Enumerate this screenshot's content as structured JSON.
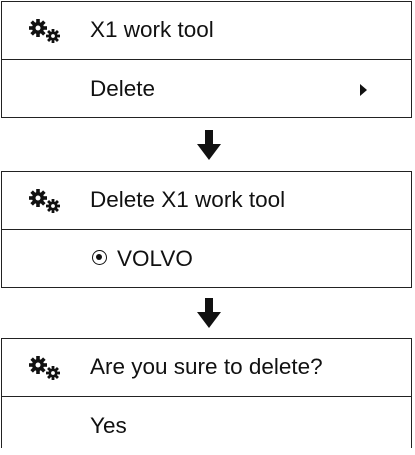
{
  "icons": {
    "settings": "gears-icon",
    "flow": "down-arrow-icon",
    "submenu": "submenu-arrow-icon",
    "radio": "radio-selected-icon"
  },
  "screen1": {
    "title": "X1 work tool",
    "item_label": "Delete"
  },
  "screen2": {
    "title": "Delete X1 work tool",
    "option_label": "VOLVO",
    "option_selected": true
  },
  "screen3": {
    "title": "Are you sure to delete?",
    "confirm_label": "Yes"
  }
}
